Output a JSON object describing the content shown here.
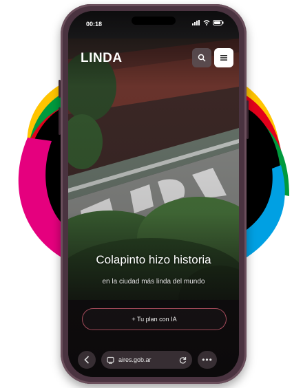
{
  "status_bar": {
    "time": "00:18"
  },
  "header": {
    "logo": "LINDA"
  },
  "icons": {
    "search": "search-icon",
    "menu": "menu-icon",
    "back": "chevron-left-icon",
    "tabs": "tabs-icon",
    "reload": "reload-icon",
    "more": "more-icon"
  },
  "hero": {
    "title": "Colapinto hizo historia",
    "subtitle": "en la ciudad más linda del mundo"
  },
  "cta": {
    "label": "+ Tu plan con IA"
  },
  "browser": {
    "url": "aires.gob.ar",
    "more": "•••"
  },
  "colors": {
    "yellow": "#ffc400",
    "green": "#009a3e",
    "red": "#e3001b",
    "blue": "#00a0e3",
    "magenta": "#e5007e",
    "phone_frame": "#4a3340"
  }
}
